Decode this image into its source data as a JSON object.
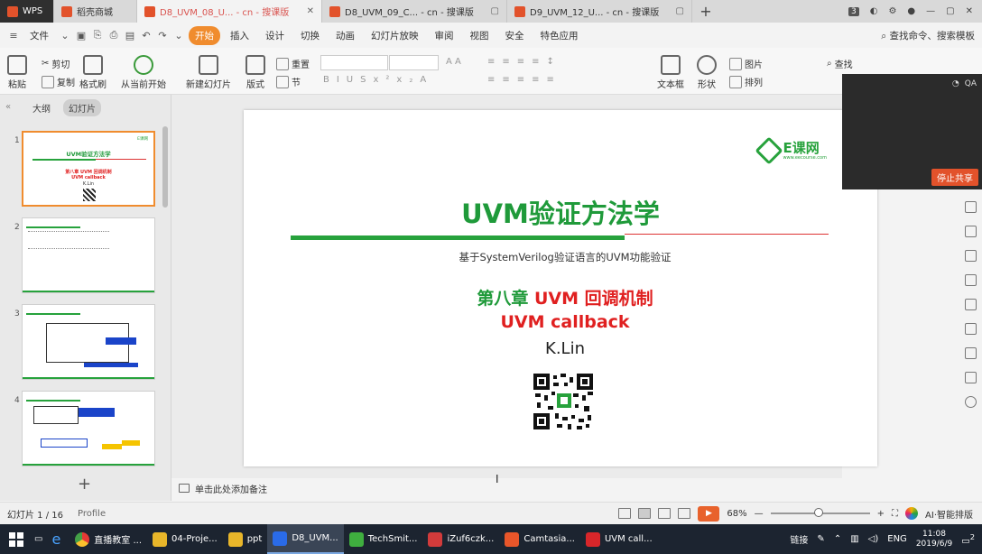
{
  "tabs": [
    {
      "label": "WPS",
      "color": "#2f2f2f"
    },
    {
      "label": "稻壳商城",
      "color": "#e2522b"
    },
    {
      "label": "D8_UVM_08_U... - cn - 搜课版",
      "color": "#e2522b",
      "active": true
    },
    {
      "label": "D8_UVM_09_C... - cn - 搜课版",
      "color": "#e2522b"
    },
    {
      "label": "D9_UVM_12_U... - cn - 搜课版",
      "color": "#e2522b"
    }
  ],
  "window_controls": {
    "count_badge": "3"
  },
  "menu": {
    "file": "文件",
    "items": [
      "开始",
      "插入",
      "设计",
      "切换",
      "动画",
      "幻灯片放映",
      "审阅",
      "视图",
      "安全",
      "特色应用"
    ],
    "active": "开始",
    "search": "查找命令、搜索模板"
  },
  "ribbon": {
    "paste": "粘贴",
    "cut": "剪切",
    "copy": "复制",
    "format_painter": "格式刷",
    "from_current": "从当前开始",
    "new_slide": "新建幻灯片",
    "layout": "版式",
    "reset": "重置",
    "section": "节",
    "textbox": "文本框",
    "shape": "形状",
    "picture": "图片",
    "arrange": "排列",
    "find": "查找"
  },
  "left_panel": {
    "tab_outline": "大纲",
    "tab_slides": "幻灯片",
    "slide_numbers": [
      "1",
      "2",
      "3",
      "4"
    ],
    "thumb1_title": "UVM验证方法学",
    "thumb1_line1": "第八章 UVM 回调机制",
    "thumb1_line2": "UVM callback",
    "thumb1_author": "K.Lin"
  },
  "slide": {
    "logo_text": "E课网",
    "logo_sub": "www.eecourse.com",
    "title": "UVM验证方法学",
    "subtitle": "基于SystemVerilog验证语言的UVM功能验证",
    "chapter_prefix": "第八章",
    "chapter_rest": " UVM 回调机制",
    "callback": "UVM callback",
    "author": "K.Lin"
  },
  "webcam": {
    "stop_share": "停止共享"
  },
  "notes": {
    "placeholder": "单击此处添加备注"
  },
  "status": {
    "slide_info": "幻灯片 1 / 16",
    "profile": "Profile",
    "zoom": "68%",
    "ai_label": "AI·智能排版"
  },
  "taskbar": {
    "apps": [
      {
        "label": "直播教室 ...",
        "color": "#2a8ee8"
      },
      {
        "label": "04-Proje...",
        "color": "#e8b62a"
      },
      {
        "label": "ppt",
        "color": "#e8b62a"
      },
      {
        "label": "D8_UVM...",
        "color": "#2a6be8",
        "active": true
      },
      {
        "label": "TechSmit...",
        "color": "#3fae3f"
      },
      {
        "label": "iZuf6czk...",
        "color": "#d23b3b"
      },
      {
        "label": "Camtasia...",
        "color": "#e8562a"
      },
      {
        "label": "UVM call...",
        "color": "#d8262a"
      }
    ],
    "link_label": "链接",
    "lang": "ENG",
    "time": "11:08",
    "date": "2019/6/9",
    "notif_count": "2"
  },
  "colors": {
    "accent": "#f08c2e",
    "green": "#27a23c",
    "red": "#e02020"
  }
}
